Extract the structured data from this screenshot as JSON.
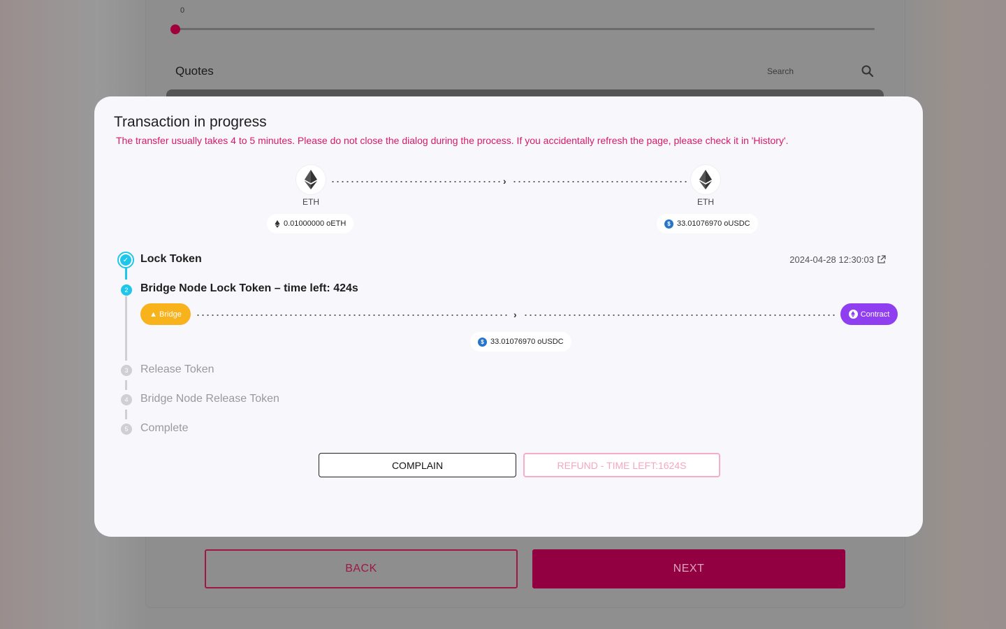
{
  "background": {
    "slider_value": "0",
    "quotes_title": "Quotes",
    "search_placeholder": "Search",
    "back_label": "BACK",
    "next_label": "NEXT"
  },
  "modal": {
    "title": "Transaction in progress",
    "warning": "The transfer usually takes 4 to 5 minutes. Please do not close the dialog during the process. If you accidentally refresh the page, please check it in 'History'.",
    "source_chain": "ETH",
    "target_chain": "ETH",
    "source_amount": "0.01000000 oETH",
    "target_amount": "33.01076970 oUSDC",
    "steps": [
      {
        "num": "1",
        "label": "Lock Token",
        "status": "done",
        "time": "2024-04-28 12:30:03"
      },
      {
        "num": "2",
        "label": "Bridge Node Lock Token – time left: 424s",
        "status": "active"
      },
      {
        "num": "3",
        "label": "Release Token",
        "status": "pending"
      },
      {
        "num": "4",
        "label": "Bridge Node Release Token",
        "status": "pending"
      },
      {
        "num": "5",
        "label": "Complete",
        "status": "pending"
      }
    ],
    "bridge_label": "Bridge",
    "contract_label": "Contract",
    "bridge_amount": "33.01076970 oUSDC",
    "complain_label": "COMPLAIN",
    "refund_label": "REFUND - TIME LEFT:1624S"
  },
  "colors": {
    "accent": "#d61a68",
    "step_active": "#1ec6ea",
    "bridge": "#f8b21c",
    "contract": "#8f3ff0",
    "next_button": "#930041"
  }
}
